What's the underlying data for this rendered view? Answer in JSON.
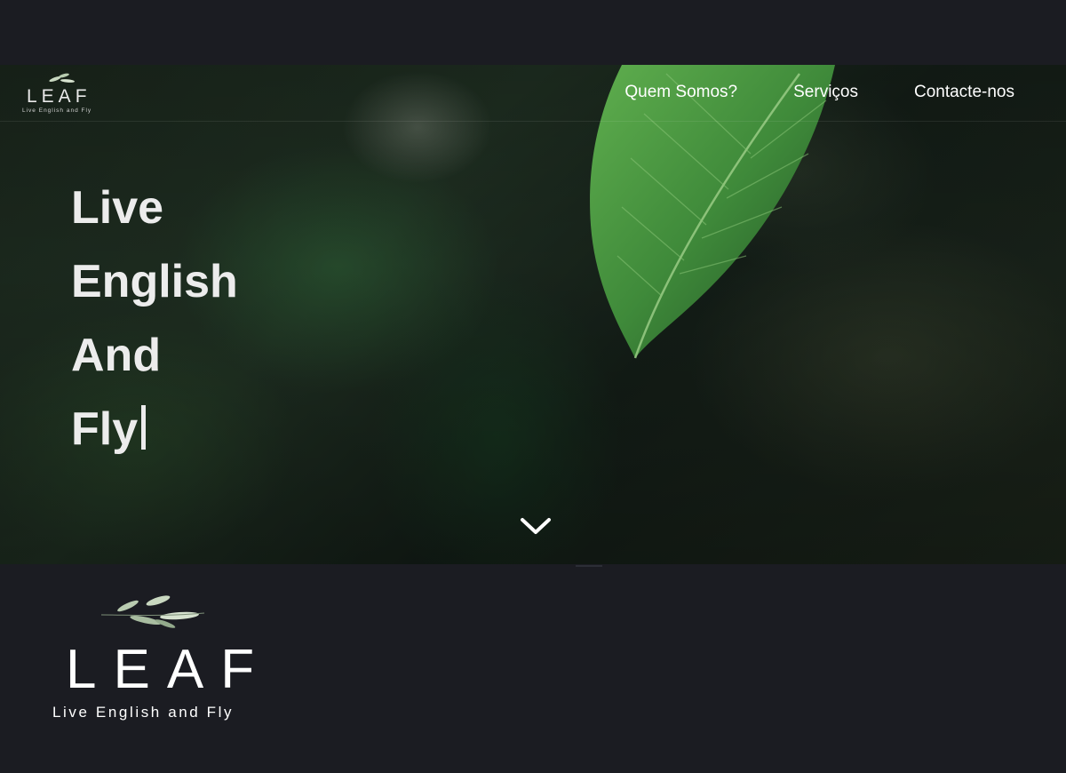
{
  "brand": {
    "name": "LEAF",
    "tagline": "Live English and Fly"
  },
  "nav": {
    "items": [
      {
        "label": "Quem Somos?"
      },
      {
        "label": "Serviços"
      },
      {
        "label": "Contacte-nos"
      }
    ]
  },
  "hero": {
    "headline_lines": [
      "Live",
      "English",
      "And",
      "Fly"
    ],
    "scroll_icon": "chevron-down-icon"
  },
  "footer": {
    "logo_name": "LEAF",
    "logo_tagline": "Live English and Fly"
  },
  "colors": {
    "background": "#1b1c22",
    "text": "#ffffff",
    "headline": "#ececec",
    "leaf_green": "#3f8a3a"
  }
}
